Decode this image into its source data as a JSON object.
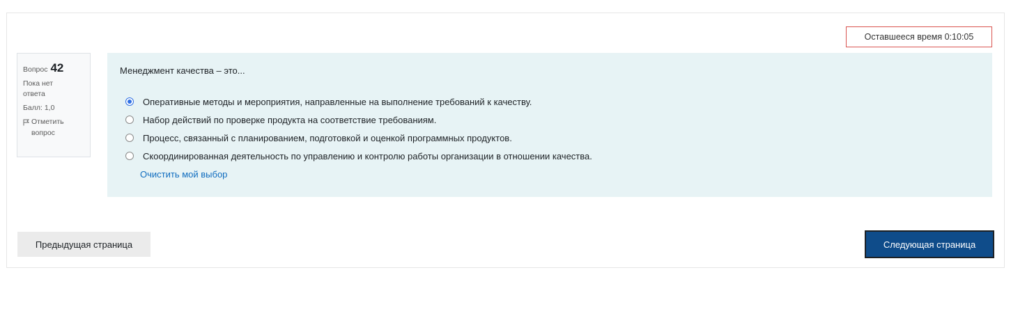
{
  "timer": {
    "text": "Оставшееся время 0:10:05"
  },
  "question_info": {
    "label": "Вопрос",
    "number": "42",
    "state_line1": "Пока нет",
    "state_line2": "ответа",
    "grade": "Балл: 1,0",
    "flag_line1": "Отметить",
    "flag_line2": "вопрос"
  },
  "question": {
    "text": "Менеджмент качества – это...",
    "selected_index": 0,
    "answers": [
      "Оперативные методы и мероприятия, направленные на выполнение требований к качеству.",
      "Набор действий по проверке продукта на соответствие требованиям.",
      "Процесс, связанный с планированием, подготовкой и оценкой программных продуктов.",
      "Скоординированная деятельность по управлению и контролю работы организации в отношении качества."
    ],
    "clear_label": "Очистить мой выбор"
  },
  "navigation": {
    "prev_label": "Предыдущая страница",
    "next_label": "Следующая страница"
  },
  "colors": {
    "accent": "#0f6cbf",
    "content_bg": "#e7f3f5",
    "timer_border": "#d9534f",
    "next_button_bg": "#0f4c8a"
  }
}
